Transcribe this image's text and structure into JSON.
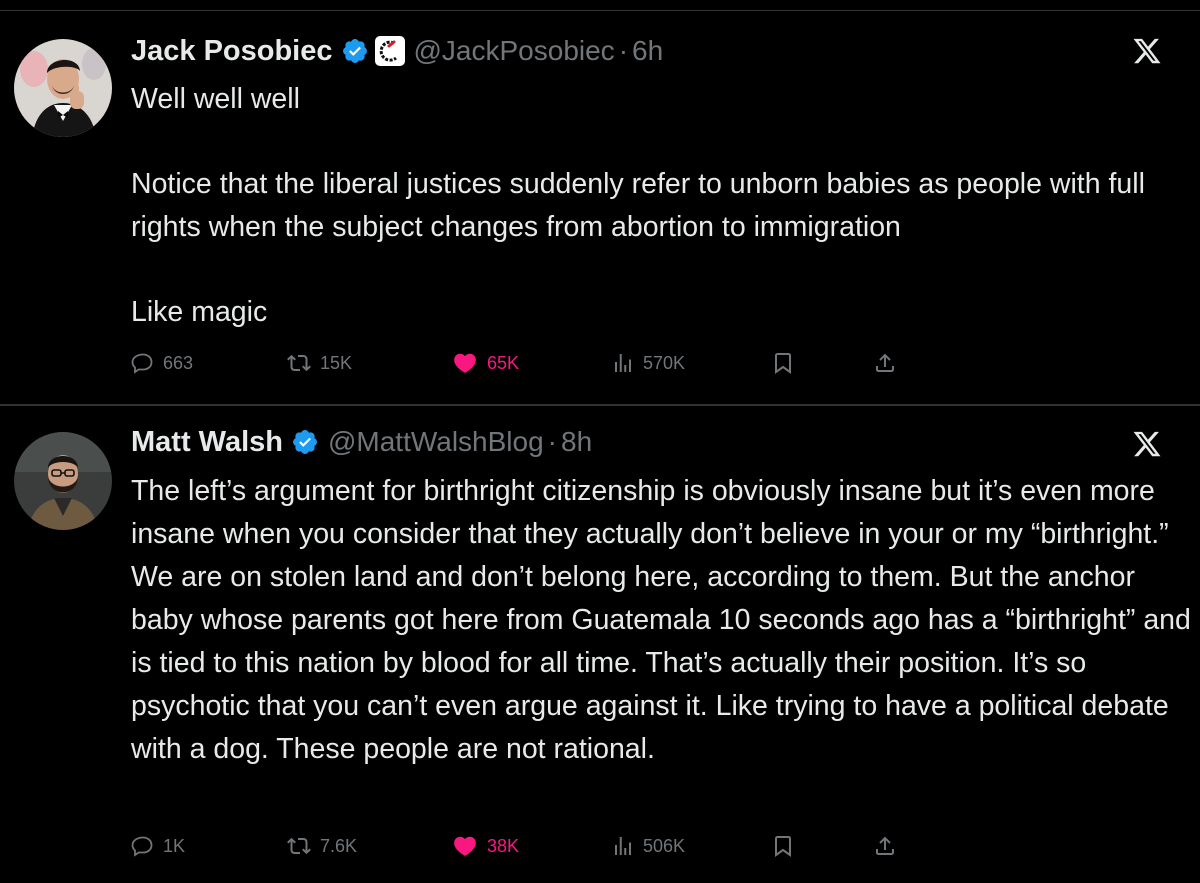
{
  "tweets": [
    {
      "name": "Jack Posobiec",
      "handle": "@JackPosobiec",
      "separator": "·",
      "time": "6h",
      "body": "Well well well\n\nNotice that the liberal justices suddenly refer to unborn babies as people with full rights when the subject changes from abortion to immigration\n\nLike magic",
      "replies": "663",
      "reposts": "15K",
      "likes": "65K",
      "views": "570K"
    },
    {
      "name": "Matt Walsh",
      "handle": "@MattWalshBlog",
      "separator": "·",
      "time": "8h",
      "body": "The left’s argument for birthright citizenship is obviously insane but it’s even more insane when you consider that they actually don’t believe in your or my “birthright.” We are on stolen land and don’t belong here, according to them. But the anchor baby whose parents got here from Guatemala 10 seconds ago has a “birthright” and is tied to this nation by blood for all time. That’s actually their position. It’s so psychotic that you can’t even argue against it. Like trying to have a political debate with a dog. These people are not rational.",
      "replies": "1K",
      "reposts": "7.6K",
      "likes": "38K",
      "views": "506K"
    }
  ],
  "colors": {
    "background": "#000000",
    "text": "#e7e9ea",
    "muted": "#71767b",
    "verified": "#1d9bf0",
    "like": "#f91880",
    "divider": "#2f3336"
  },
  "icons": [
    "verified-badge-icon",
    "affiliate-badge-icon",
    "x-logo-icon",
    "reply-icon",
    "repost-icon",
    "like-icon",
    "views-icon",
    "bookmark-icon",
    "share-icon"
  ]
}
